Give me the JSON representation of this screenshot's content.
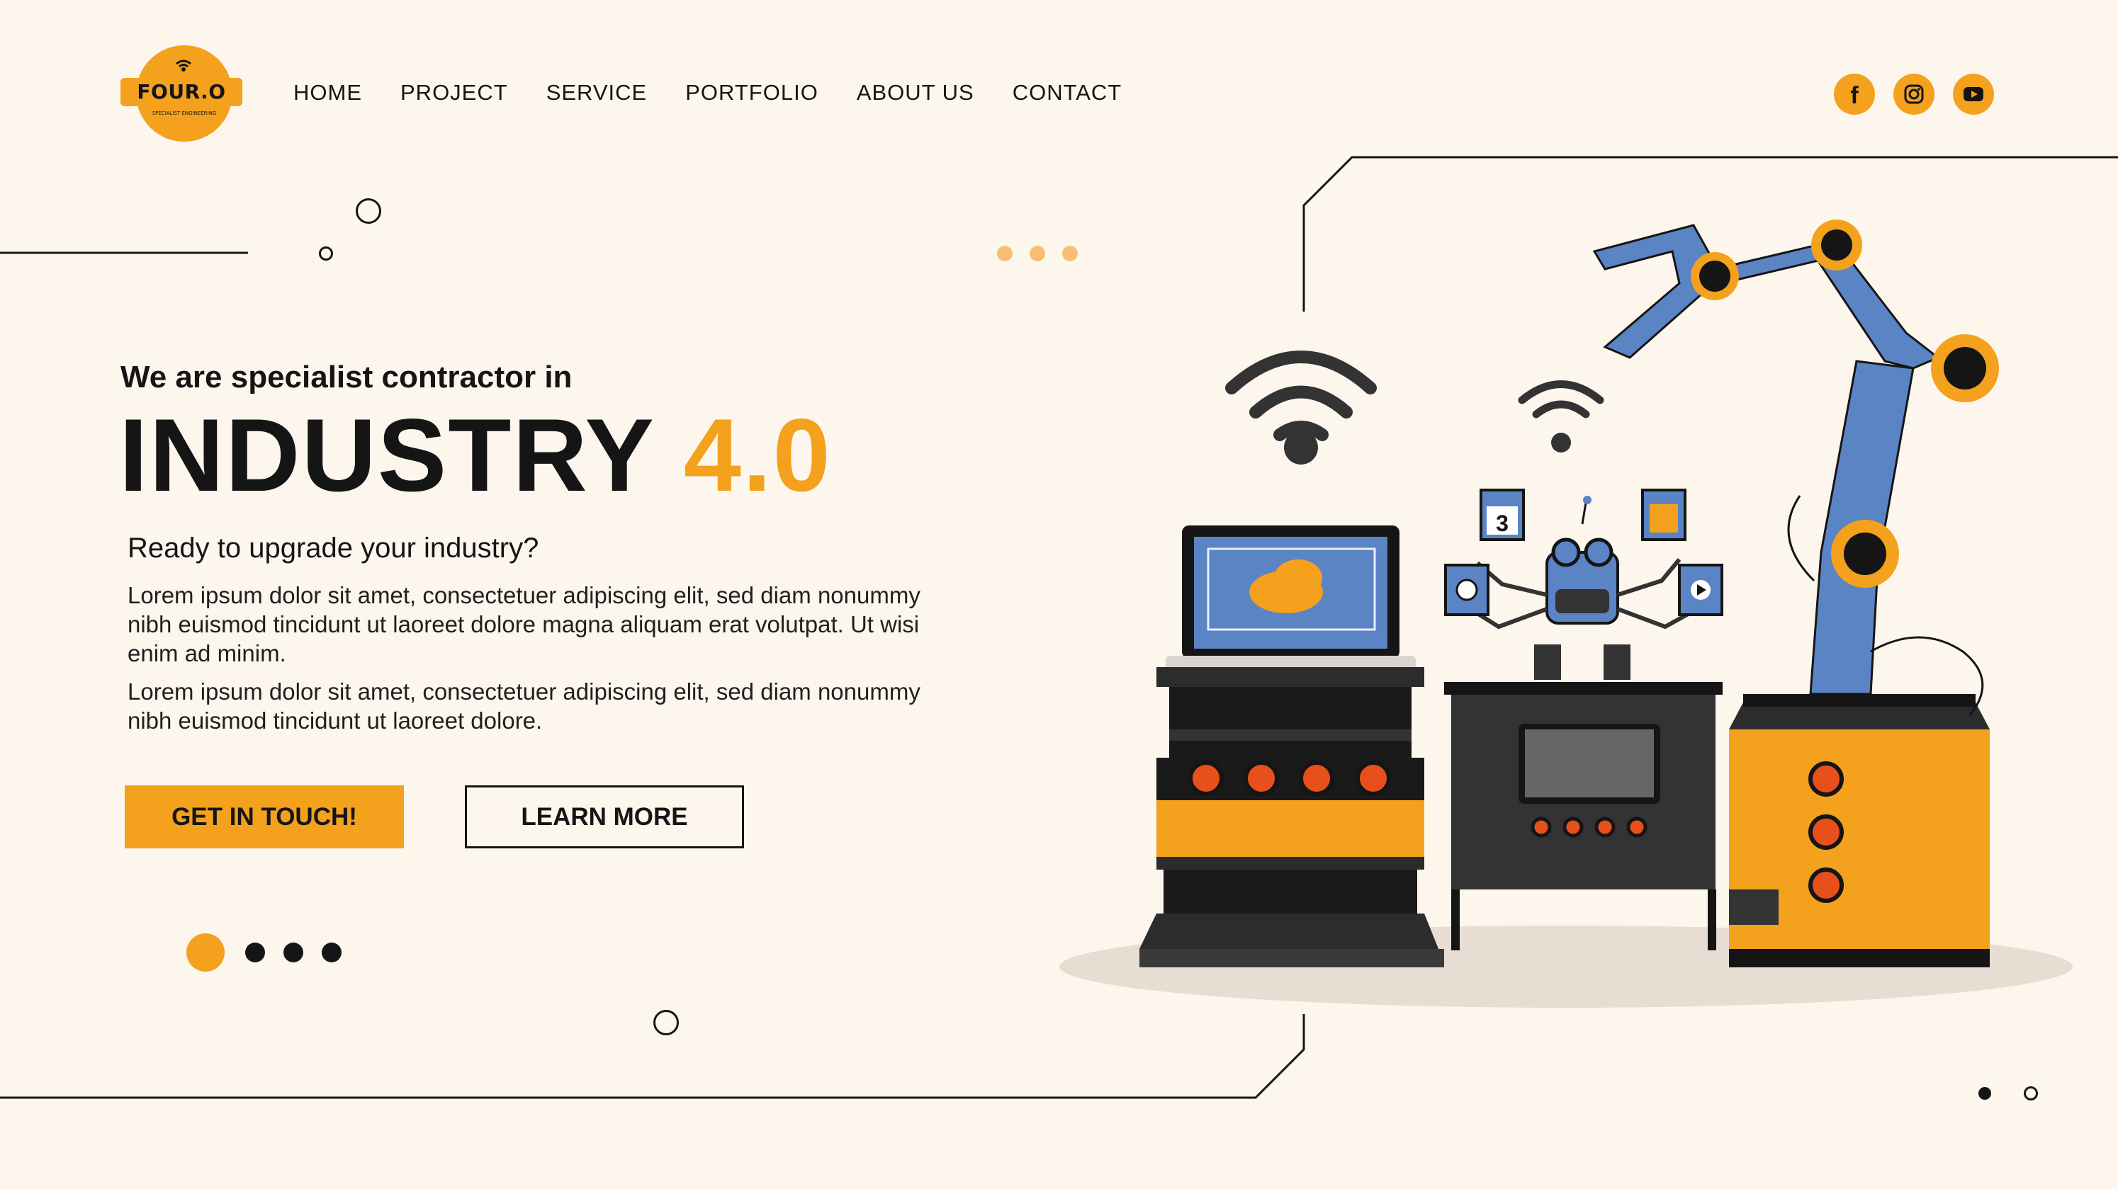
{
  "brand": {
    "name": "FOUR.O",
    "tagline": "SPECIALIST ENGINEERING",
    "accent_color": "#f4a11d",
    "background_color": "#fdf6ed"
  },
  "nav": {
    "items": [
      "HOME",
      "PROJECT",
      "SERVICE",
      "PORTFOLIO",
      "ABOUT US",
      "CONTACT"
    ]
  },
  "social": [
    {
      "icon": "facebook-icon",
      "glyph": "f"
    },
    {
      "icon": "instagram-icon",
      "glyph": ""
    },
    {
      "icon": "youtube-icon",
      "glyph": ""
    }
  ],
  "hero": {
    "subtitle": "We are specialist contractor in",
    "title_main": "INDUSTRY",
    "title_accent": "4.0",
    "question": "Ready to upgrade your industry?",
    "paragraph_1": "Lorem ipsum dolor sit amet, consectetuer adipiscing elit, sed diam nonummy nibh euismod tincidunt ut laoreet dolore magna aliquam erat volutpat. Ut wisi enim ad minim.",
    "paragraph_2": "Lorem ipsum dolor sit amet, consectetuer adipiscing elit, sed diam nonummy nibh euismod tincidunt ut laoreet dolore.",
    "cta_primary": "GET IN TOUCH!",
    "cta_secondary": "LEARN MORE"
  },
  "carousel": {
    "total_slides": 4,
    "active_slide": 1
  },
  "illustration": {
    "calendar_number": "3"
  }
}
